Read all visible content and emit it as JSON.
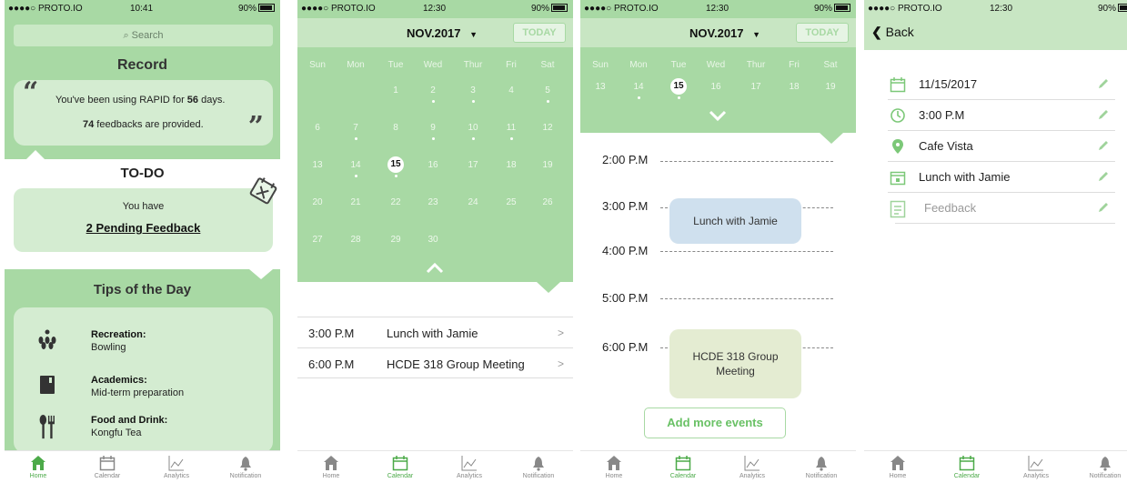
{
  "status": {
    "carrier": "●●●●○ PROTO.IO",
    "battery": "90%"
  },
  "screen1": {
    "time": "10:41",
    "search_placeholder": "Search",
    "record_title": "Record",
    "record_line1_pre": "You've been using RAPID for ",
    "record_days": "56",
    "record_line1_post": " days.",
    "record_feedbacks": "74",
    "record_line2_post": " feedbacks are provided.",
    "todo_title": "TO-DO",
    "todo_line1": "You have",
    "todo_link": "2 Pending Feedback",
    "tips_title": "Tips of the Day",
    "tips": [
      {
        "title": "Recreation:",
        "desc": "Bowling",
        "icon": "bowling-icon"
      },
      {
        "title": "Academics:",
        "desc": "Mid-term preparation",
        "icon": "book-icon"
      },
      {
        "title": "Food and Drink:",
        "desc": "Kongfu Tea",
        "icon": "fork-knife-icon"
      }
    ]
  },
  "tabs": [
    "Home",
    "Calendar",
    "Analytics",
    "Notification"
  ],
  "screen2": {
    "time": "12:30",
    "month": "NOV.2017",
    "today": "TODAY",
    "weekdays": [
      "Sun",
      "Mon",
      "Tue",
      "Wed",
      "Thur",
      "Fri",
      "Sat"
    ],
    "weeks": [
      [
        "",
        "",
        "1",
        "2",
        "3",
        "4",
        "5"
      ],
      [
        "6",
        "7",
        "8",
        "9",
        "10",
        "11",
        "12"
      ],
      [
        "13",
        "14",
        "15",
        "16",
        "17",
        "18",
        "19"
      ],
      [
        "20",
        "21",
        "22",
        "23",
        "24",
        "25",
        "26"
      ],
      [
        "27",
        "28",
        "29",
        "30",
        "",
        "",
        ""
      ]
    ],
    "selected": "15",
    "events": [
      {
        "time": "3:00 P.M",
        "name": "Lunch with Jamie"
      },
      {
        "time": "6:00 P.M",
        "name": "HCDE 318 Group Meeting"
      }
    ]
  },
  "screen3": {
    "time": "12:30",
    "month": "NOV.2017",
    "today": "TODAY",
    "week": [
      "13",
      "14",
      "15",
      "16",
      "17",
      "18",
      "19"
    ],
    "hours": [
      "2:00 P.M",
      "3:00 P.M",
      "4:00 P.M",
      "5:00 P.M",
      "6:00 P.M"
    ],
    "event1": "Lunch with Jamie",
    "event2_l1": "HCDE 318 Group",
    "event2_l2": "Meeting",
    "add_button": "Add more events"
  },
  "screen4": {
    "time": "12:30",
    "back": "Back",
    "date": "11/15/2017",
    "time_value": "3:00 P.M",
    "location": "Cafe Vista",
    "title": "Lunch with Jamie",
    "feedback_placeholder": "Feedback"
  },
  "colors": {
    "accent": "#a8d9a4",
    "light": "#d4ecd1",
    "active_tab": "#4caa49"
  }
}
